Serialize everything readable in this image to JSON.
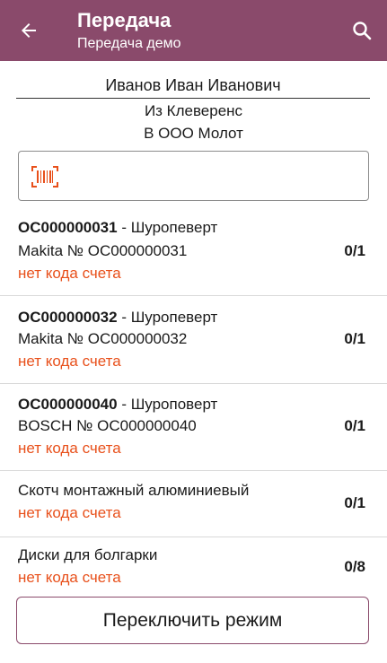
{
  "header": {
    "title": "Передача",
    "subtitle": "Передача демо",
    "back_icon": "arrow-left-icon",
    "search_icon": "search-icon"
  },
  "document": {
    "person": "Иванов Иван Иванович",
    "from": "Из Клеверенс",
    "to": "В ООО Молот"
  },
  "scan": {
    "icon": "barcode-icon",
    "value": "",
    "placeholder": ""
  },
  "items": [
    {
      "code": "OC000000031",
      "name": " - Шуропеверт",
      "detail": "Makita № OC000000031",
      "status": "нет кода счета",
      "qty": "0/1"
    },
    {
      "code": "OC000000032",
      "name": " - Шуропеверт",
      "detail": "Makita № OC000000032",
      "status": "нет кода счета",
      "qty": "0/1"
    },
    {
      "code": "OC000000040",
      "name": " - Шуроповерт",
      "detail": "BOSCH № OC000000040",
      "status": "нет кода счета",
      "qty": "0/1"
    },
    {
      "code": "",
      "name": "Скотч монтажный алюминиевый",
      "detail": "",
      "status": "нет кода счета",
      "qty": "0/1"
    },
    {
      "code": "",
      "name": "Диски для болгарки",
      "detail": "",
      "status": "нет кода счета",
      "qty": "0/8"
    }
  ],
  "footer": {
    "switch_label": "Переключить режим"
  },
  "colors": {
    "accent": "#8a4a6b",
    "warning": "#e8501b"
  }
}
